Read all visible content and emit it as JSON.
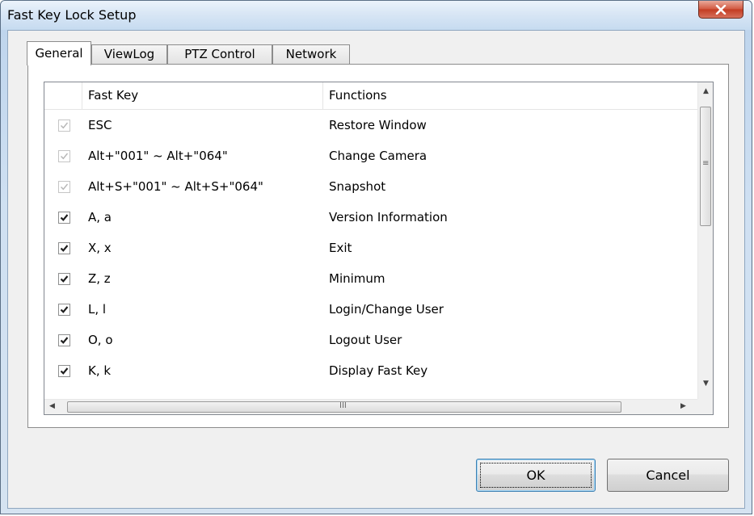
{
  "window": {
    "title": "Fast Key Lock Setup"
  },
  "tabs": [
    {
      "label": "General",
      "active": true
    },
    {
      "label": "ViewLog",
      "active": false
    },
    {
      "label": "PTZ Control",
      "active": false
    },
    {
      "label": "Network",
      "active": false
    }
  ],
  "list": {
    "columns": {
      "fast_key": "Fast Key",
      "functions": "Functions"
    },
    "rows": [
      {
        "key": "ESC",
        "function": "Restore Window",
        "checked": true,
        "disabled": true
      },
      {
        "key": "Alt+\"001\" ~ Alt+\"064\"",
        "function": "Change Camera",
        "checked": true,
        "disabled": true
      },
      {
        "key": "Alt+S+\"001\" ~ Alt+S+\"064\"",
        "function": "Snapshot",
        "checked": true,
        "disabled": true
      },
      {
        "key": "A, a",
        "function": "Version Information",
        "checked": true,
        "disabled": false
      },
      {
        "key": "X, x",
        "function": "Exit",
        "checked": true,
        "disabled": false
      },
      {
        "key": "Z, z",
        "function": "Minimum",
        "checked": true,
        "disabled": false
      },
      {
        "key": "L, l",
        "function": "Login/Change User",
        "checked": true,
        "disabled": false
      },
      {
        "key": "O, o",
        "function": "Logout User",
        "checked": true,
        "disabled": false
      },
      {
        "key": "K, k",
        "function": "Display Fast Key",
        "checked": true,
        "disabled": false
      }
    ]
  },
  "buttons": {
    "ok": "OK",
    "cancel": "Cancel"
  },
  "colors": {
    "accent": "#3c7fb1",
    "close": "#c23b21"
  }
}
